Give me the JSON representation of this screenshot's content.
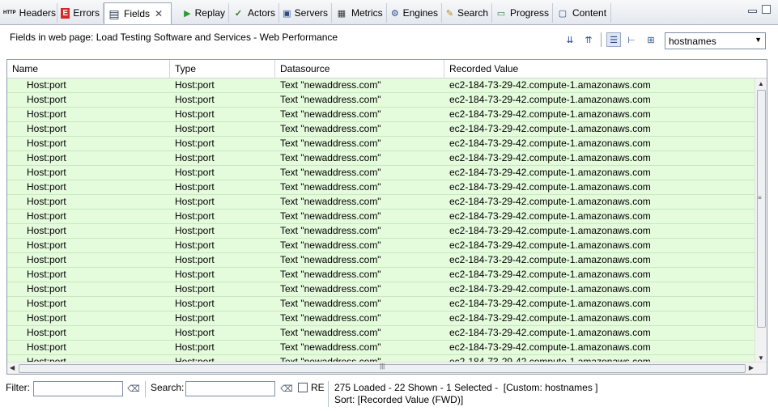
{
  "tabs": [
    {
      "label": "Headers",
      "icon": "http-icon",
      "glyph": "HTTP"
    },
    {
      "label": "Errors",
      "icon": "error-icon",
      "glyph": "E"
    },
    {
      "label": "Fields",
      "icon": "fields-table-icon",
      "glyph": "▤"
    },
    {
      "label": "Replay",
      "icon": "replay-play-icon",
      "glyph": "▶"
    },
    {
      "label": "Actors",
      "icon": "checkmark-icon",
      "glyph": "✓"
    },
    {
      "label": "Servers",
      "icon": "monitor-icon",
      "glyph": "▣"
    },
    {
      "label": "Metrics",
      "icon": "metrics-grid-icon",
      "glyph": "▦"
    },
    {
      "label": "Engines",
      "icon": "engines-icon",
      "glyph": "⚙"
    },
    {
      "label": "Search",
      "icon": "search-pen-icon",
      "glyph": "✎"
    },
    {
      "label": "Progress",
      "icon": "progress-icon",
      "glyph": "▭"
    },
    {
      "label": "Content",
      "icon": "content-window-icon",
      "glyph": "▢"
    }
  ],
  "header": {
    "title": "Fields in web page: Load Testing Software and Services - Web Performance",
    "view_select": "hostnames"
  },
  "table": {
    "columns": [
      "Name",
      "Type",
      "Datasource",
      "Recorded Value"
    ],
    "row": {
      "name": "Host:port",
      "type": "Host:port",
      "datasource": "Text \"newaddress.com\"",
      "value": "ec2-184-73-29-42.compute-1.amazonaws.com"
    },
    "visible_row_count": 20
  },
  "footer": {
    "filter_label": "Filter:",
    "search_label": "Search:",
    "re_label": "RE",
    "status_line1": "275 Loaded - 22 Shown - 1 Selected -  [Custom: hostnames ]",
    "status_line2": "Sort: [Recorded Value (FWD)]"
  },
  "colors": {
    "row_bg": "#e4fbdc",
    "accent": "#2a4d88",
    "error_red": "#d9262b"
  }
}
